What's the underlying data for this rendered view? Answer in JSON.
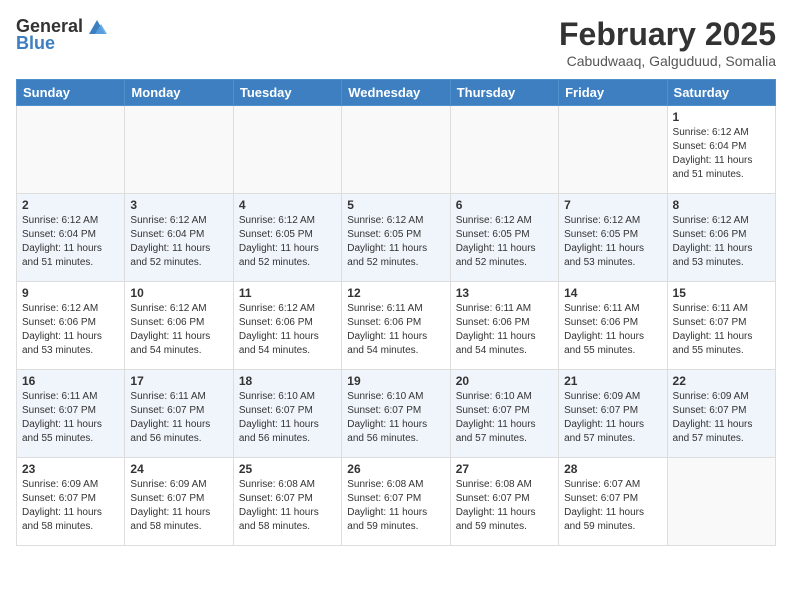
{
  "header": {
    "logo_general": "General",
    "logo_blue": "Blue",
    "month_year": "February 2025",
    "location": "Cabudwaaq, Galguduud, Somalia"
  },
  "weekdays": [
    "Sunday",
    "Monday",
    "Tuesday",
    "Wednesday",
    "Thursday",
    "Friday",
    "Saturday"
  ],
  "weeks": [
    [
      {
        "day": "",
        "sunrise": "",
        "sunset": "",
        "daylight": ""
      },
      {
        "day": "",
        "sunrise": "",
        "sunset": "",
        "daylight": ""
      },
      {
        "day": "",
        "sunrise": "",
        "sunset": "",
        "daylight": ""
      },
      {
        "day": "",
        "sunrise": "",
        "sunset": "",
        "daylight": ""
      },
      {
        "day": "",
        "sunrise": "",
        "sunset": "",
        "daylight": ""
      },
      {
        "day": "",
        "sunrise": "",
        "sunset": "",
        "daylight": ""
      },
      {
        "day": "1",
        "sunrise": "Sunrise: 6:12 AM",
        "sunset": "Sunset: 6:04 PM",
        "daylight": "Daylight: 11 hours and 51 minutes."
      }
    ],
    [
      {
        "day": "2",
        "sunrise": "Sunrise: 6:12 AM",
        "sunset": "Sunset: 6:04 PM",
        "daylight": "Daylight: 11 hours and 51 minutes."
      },
      {
        "day": "3",
        "sunrise": "Sunrise: 6:12 AM",
        "sunset": "Sunset: 6:04 PM",
        "daylight": "Daylight: 11 hours and 52 minutes."
      },
      {
        "day": "4",
        "sunrise": "Sunrise: 6:12 AM",
        "sunset": "Sunset: 6:05 PM",
        "daylight": "Daylight: 11 hours and 52 minutes."
      },
      {
        "day": "5",
        "sunrise": "Sunrise: 6:12 AM",
        "sunset": "Sunset: 6:05 PM",
        "daylight": "Daylight: 11 hours and 52 minutes."
      },
      {
        "day": "6",
        "sunrise": "Sunrise: 6:12 AM",
        "sunset": "Sunset: 6:05 PM",
        "daylight": "Daylight: 11 hours and 52 minutes."
      },
      {
        "day": "7",
        "sunrise": "Sunrise: 6:12 AM",
        "sunset": "Sunset: 6:05 PM",
        "daylight": "Daylight: 11 hours and 53 minutes."
      },
      {
        "day": "8",
        "sunrise": "Sunrise: 6:12 AM",
        "sunset": "Sunset: 6:06 PM",
        "daylight": "Daylight: 11 hours and 53 minutes."
      }
    ],
    [
      {
        "day": "9",
        "sunrise": "Sunrise: 6:12 AM",
        "sunset": "Sunset: 6:06 PM",
        "daylight": "Daylight: 11 hours and 53 minutes."
      },
      {
        "day": "10",
        "sunrise": "Sunrise: 6:12 AM",
        "sunset": "Sunset: 6:06 PM",
        "daylight": "Daylight: 11 hours and 54 minutes."
      },
      {
        "day": "11",
        "sunrise": "Sunrise: 6:12 AM",
        "sunset": "Sunset: 6:06 PM",
        "daylight": "Daylight: 11 hours and 54 minutes."
      },
      {
        "day": "12",
        "sunrise": "Sunrise: 6:11 AM",
        "sunset": "Sunset: 6:06 PM",
        "daylight": "Daylight: 11 hours and 54 minutes."
      },
      {
        "day": "13",
        "sunrise": "Sunrise: 6:11 AM",
        "sunset": "Sunset: 6:06 PM",
        "daylight": "Daylight: 11 hours and 54 minutes."
      },
      {
        "day": "14",
        "sunrise": "Sunrise: 6:11 AM",
        "sunset": "Sunset: 6:06 PM",
        "daylight": "Daylight: 11 hours and 55 minutes."
      },
      {
        "day": "15",
        "sunrise": "Sunrise: 6:11 AM",
        "sunset": "Sunset: 6:07 PM",
        "daylight": "Daylight: 11 hours and 55 minutes."
      }
    ],
    [
      {
        "day": "16",
        "sunrise": "Sunrise: 6:11 AM",
        "sunset": "Sunset: 6:07 PM",
        "daylight": "Daylight: 11 hours and 55 minutes."
      },
      {
        "day": "17",
        "sunrise": "Sunrise: 6:11 AM",
        "sunset": "Sunset: 6:07 PM",
        "daylight": "Daylight: 11 hours and 56 minutes."
      },
      {
        "day": "18",
        "sunrise": "Sunrise: 6:10 AM",
        "sunset": "Sunset: 6:07 PM",
        "daylight": "Daylight: 11 hours and 56 minutes."
      },
      {
        "day": "19",
        "sunrise": "Sunrise: 6:10 AM",
        "sunset": "Sunset: 6:07 PM",
        "daylight": "Daylight: 11 hours and 56 minutes."
      },
      {
        "day": "20",
        "sunrise": "Sunrise: 6:10 AM",
        "sunset": "Sunset: 6:07 PM",
        "daylight": "Daylight: 11 hours and 57 minutes."
      },
      {
        "day": "21",
        "sunrise": "Sunrise: 6:09 AM",
        "sunset": "Sunset: 6:07 PM",
        "daylight": "Daylight: 11 hours and 57 minutes."
      },
      {
        "day": "22",
        "sunrise": "Sunrise: 6:09 AM",
        "sunset": "Sunset: 6:07 PM",
        "daylight": "Daylight: 11 hours and 57 minutes."
      }
    ],
    [
      {
        "day": "23",
        "sunrise": "Sunrise: 6:09 AM",
        "sunset": "Sunset: 6:07 PM",
        "daylight": "Daylight: 11 hours and 58 minutes."
      },
      {
        "day": "24",
        "sunrise": "Sunrise: 6:09 AM",
        "sunset": "Sunset: 6:07 PM",
        "daylight": "Daylight: 11 hours and 58 minutes."
      },
      {
        "day": "25",
        "sunrise": "Sunrise: 6:08 AM",
        "sunset": "Sunset: 6:07 PM",
        "daylight": "Daylight: 11 hours and 58 minutes."
      },
      {
        "day": "26",
        "sunrise": "Sunrise: 6:08 AM",
        "sunset": "Sunset: 6:07 PM",
        "daylight": "Daylight: 11 hours and 59 minutes."
      },
      {
        "day": "27",
        "sunrise": "Sunrise: 6:08 AM",
        "sunset": "Sunset: 6:07 PM",
        "daylight": "Daylight: 11 hours and 59 minutes."
      },
      {
        "day": "28",
        "sunrise": "Sunrise: 6:07 AM",
        "sunset": "Sunset: 6:07 PM",
        "daylight": "Daylight: 11 hours and 59 minutes."
      },
      {
        "day": "",
        "sunrise": "",
        "sunset": "",
        "daylight": ""
      }
    ]
  ]
}
